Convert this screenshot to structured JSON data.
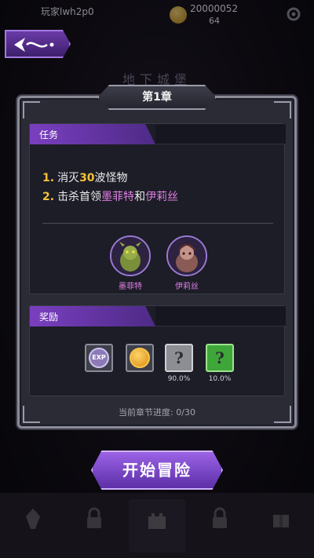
{
  "topbar": {
    "player_name": "玩家lwh2p0",
    "coins": "20000052",
    "gems": "64"
  },
  "background": {
    "chapter_title_hint": "地下城堡"
  },
  "panel": {
    "chapter_title": "第1章",
    "tasks": {
      "header": "任务",
      "items": [
        {
          "num": "1.",
          "pre": "消灭",
          "highlight": "30",
          "post": "波怪物"
        },
        {
          "num": "2.",
          "pre": "击杀首领",
          "boss1": "墨菲特",
          "mid": "和",
          "boss2": "伊莉丝"
        }
      ]
    },
    "bosses": [
      {
        "name": "墨菲特"
      },
      {
        "name": "伊莉丝"
      }
    ],
    "rewards": {
      "header": "奖励",
      "items": [
        {
          "icon": "exp-icon",
          "label": "EXP",
          "chance": ""
        },
        {
          "icon": "gold-coin-icon",
          "chance": ""
        },
        {
          "icon": "mystery-gray-chest-icon",
          "chance": "90.0%"
        },
        {
          "icon": "mystery-green-chest-icon",
          "chance": "10.0%"
        }
      ]
    },
    "progress_label": "当前章节进度: 0/30"
  },
  "start_button": "开始冒险",
  "colors": {
    "accent_purple": "#7a3fc0",
    "highlight_yellow": "#f3c23a",
    "boss_pink": "#e07de6"
  }
}
